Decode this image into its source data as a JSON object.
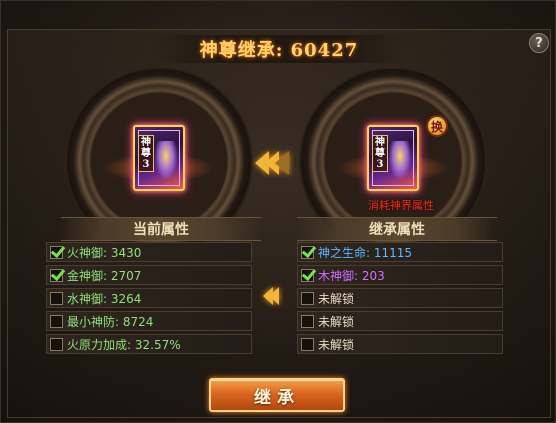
{
  "header": {
    "title": "神尊继承: 60427",
    "help_label": "?"
  },
  "source_card": {
    "label": "神尊3"
  },
  "target_card": {
    "label": "神尊3",
    "swap_label": "换",
    "consume_text": "消耗神界属性"
  },
  "current_attributes": {
    "title": "当前属性",
    "items": [
      {
        "text": "火神御: 3430",
        "checked": true,
        "color": "#8fe07a"
      },
      {
        "text": "金神御: 2707",
        "checked": true,
        "color": "#8fe07a"
      },
      {
        "text": "水神御: 3264",
        "checked": false,
        "color": "#8fe07a"
      },
      {
        "text": "最小神防: 8724",
        "checked": false,
        "color": "#8fe07a"
      },
      {
        "text": "火原力加成: 32.57%",
        "checked": false,
        "color": "#8fe07a"
      }
    ]
  },
  "inherit_attributes": {
    "title": "继承属性",
    "items": [
      {
        "text": "神之生命: 11115",
        "checked": true,
        "color": "#5cb8ff"
      },
      {
        "text": "木神御: 203",
        "checked": true,
        "color": "#d070ff"
      },
      {
        "text": "未解锁",
        "checked": false,
        "color": "#e8dcc4"
      },
      {
        "text": "未解锁",
        "checked": false,
        "color": "#e8dcc4"
      },
      {
        "text": "未解锁",
        "checked": false,
        "color": "#e8dcc4"
      }
    ]
  },
  "inherit_button": {
    "label": "继承"
  }
}
